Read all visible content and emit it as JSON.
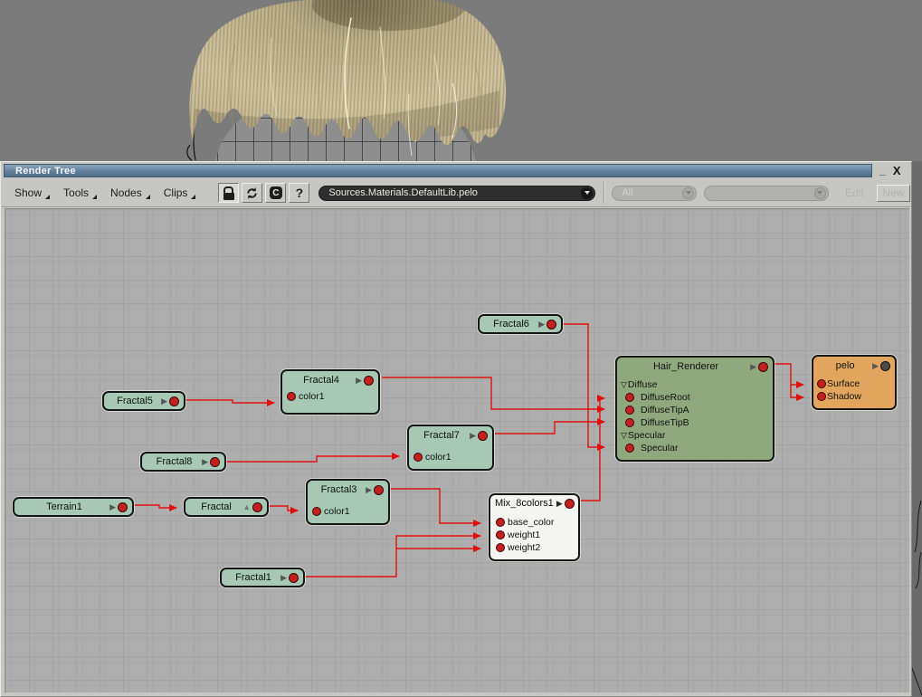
{
  "window": {
    "title": "Render Tree",
    "minimize_glyph": "_",
    "close_glyph": "X"
  },
  "menubar": {
    "menus": [
      {
        "label": "Show"
      },
      {
        "label": "Tools"
      },
      {
        "label": "Nodes"
      },
      {
        "label": "Clips"
      }
    ],
    "clip_button_glyph": "C",
    "help_button_glyph": "?",
    "material_selector_value": "Sources.Materials.DefaultLib.pelo",
    "filter_selector_value": "All",
    "shader_selector_value": "",
    "edit_label": "Edit",
    "new_label": "New"
  },
  "graph": {
    "nodes": {
      "fractal6": {
        "name": "Fractal6"
      },
      "fractal5": {
        "name": "Fractal5"
      },
      "fractal4": {
        "name": "Fractal4",
        "inputs": [
          "color1"
        ]
      },
      "fractal8": {
        "name": "Fractal8"
      },
      "fractal7": {
        "name": "Fractal7",
        "inputs": [
          "color1"
        ]
      },
      "terrain1": {
        "name": "Terrain1"
      },
      "fractal": {
        "name": "Fractal"
      },
      "fractal3": {
        "name": "Fractal3",
        "inputs": [
          "color1"
        ]
      },
      "mix": {
        "name": "Mix_8colors1",
        "inputs": [
          "base_color",
          "weight1",
          "weight2"
        ]
      },
      "fractal1": {
        "name": "Fractal1"
      },
      "hair": {
        "name": "Hair_Renderer",
        "rows": [
          {
            "kind": "group",
            "label": "Diffuse"
          },
          {
            "kind": "port",
            "label": "DiffuseRoot"
          },
          {
            "kind": "port",
            "label": "DiffuseTipA"
          },
          {
            "kind": "port",
            "label": "DiffuseTipB"
          },
          {
            "kind": "group",
            "label": "Specular"
          },
          {
            "kind": "port",
            "label": "Specular"
          }
        ]
      },
      "pelo": {
        "name": "pelo",
        "inputs": [
          "Surface",
          "Shadow"
        ]
      }
    },
    "connections": [
      {
        "from": "Fractal5",
        "to": "Fractal4.color1"
      },
      {
        "from": "Fractal8",
        "to": "Fractal7.color1"
      },
      {
        "from": "Terrain1",
        "to": "Fractal"
      },
      {
        "from": "Fractal",
        "to": "Fractal3.color1"
      },
      {
        "from": "Fractal3",
        "to": "Mix_8colors1.base_color"
      },
      {
        "from": "Fractal1",
        "to": "Mix_8colors1.weight1"
      },
      {
        "from": "Fractal1",
        "to": "Mix_8colors1.weight2"
      },
      {
        "from": "Fractal4",
        "to": "Hair_Renderer.DiffuseTipA"
      },
      {
        "from": "Fractal7",
        "to": "Hair_Renderer.DiffuseTipB"
      },
      {
        "from": "Fractal6",
        "to": "Hair_Renderer.Specular"
      },
      {
        "from": "Mix_8colors1",
        "to": "Hair_Renderer.DiffuseRoot"
      },
      {
        "from": "Hair_Renderer",
        "to": "pelo.Surface"
      },
      {
        "from": "Hair_Renderer",
        "to": "pelo.Shadow"
      }
    ]
  },
  "colors": {
    "wire_red": "#e01010",
    "node_teal": "#a6c8b4",
    "node_green": "#90a87e",
    "node_orange": "#e2a55e",
    "node_white": "#f4f4f2",
    "titlebar_blue": "#62809c",
    "chrome_gray": "#c6c6c2",
    "grid_gray": "#aeaeae"
  }
}
